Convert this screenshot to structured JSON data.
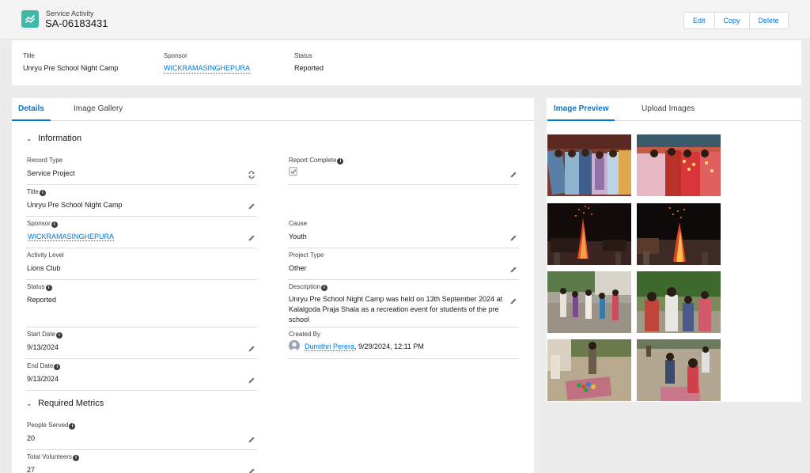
{
  "header": {
    "object_type": "Service Activity",
    "record_name": "SA-06183431",
    "icon": "service-activity-icon",
    "buttons": {
      "edit": "Edit",
      "copy": "Copy",
      "delete": "Delete"
    }
  },
  "highlights": {
    "title_label": "Title",
    "title_value": "Unryu Pre School Night Camp",
    "sponsor_label": "Sponsor",
    "sponsor_value": "WICKRAMASINGHEPURA",
    "status_label": "Status",
    "status_value": "Reported"
  },
  "main_tabs": {
    "details": "Details",
    "gallery": "Image Gallery"
  },
  "information": {
    "section_title": "Information",
    "record_type_label": "Record Type",
    "record_type_value": "Service Project",
    "report_complete_label": "Report Complete",
    "report_complete_value": true,
    "title_label": "Title",
    "title_value": "Unryu Pre School Night Camp",
    "sponsor_label": "Sponsor",
    "sponsor_value": "WICKRAMASINGHEPURA",
    "cause_label": "Cause",
    "cause_value": "Youth",
    "activity_level_label": "Activity Level",
    "activity_level_value": "Lions Club",
    "project_type_label": "Project Type",
    "project_type_value": "Other",
    "status_label": "Status",
    "status_value": "Reported",
    "description_label": "Description",
    "description_value": "Unryu Pre School Night Camp was held on 13th September 2024 at Kalalgoda Praja Shala as a recreation event for students of the pre school",
    "start_date_label": "Start Date",
    "start_date_value": "9/13/2024",
    "created_by_label": "Created By",
    "created_by_name": "Dumithri Perera",
    "created_by_date": ", 9/29/2024, 12:11 PM",
    "end_date_label": "End Date",
    "end_date_value": "9/13/2024"
  },
  "required_metrics": {
    "section_title": "Required Metrics",
    "people_served_label": "People Served",
    "people_served_value": "20",
    "total_volunteers_label": "Total Volunteers",
    "total_volunteers_value": "27"
  },
  "side_tabs": {
    "preview": "Image Preview",
    "upload": "Upload Images"
  },
  "images": [
    "children-sleeping-photo-1",
    "children-sleeping-photo-2",
    "campfire-photo-1",
    "campfire-photo-2",
    "outdoor-games-photo-1",
    "outdoor-games-photo-2",
    "outdoor-activity-photo-1",
    "outdoor-activity-photo-2"
  ],
  "colors": {
    "brand": "#0176d3",
    "icon_teal": "#3fb8a7"
  }
}
